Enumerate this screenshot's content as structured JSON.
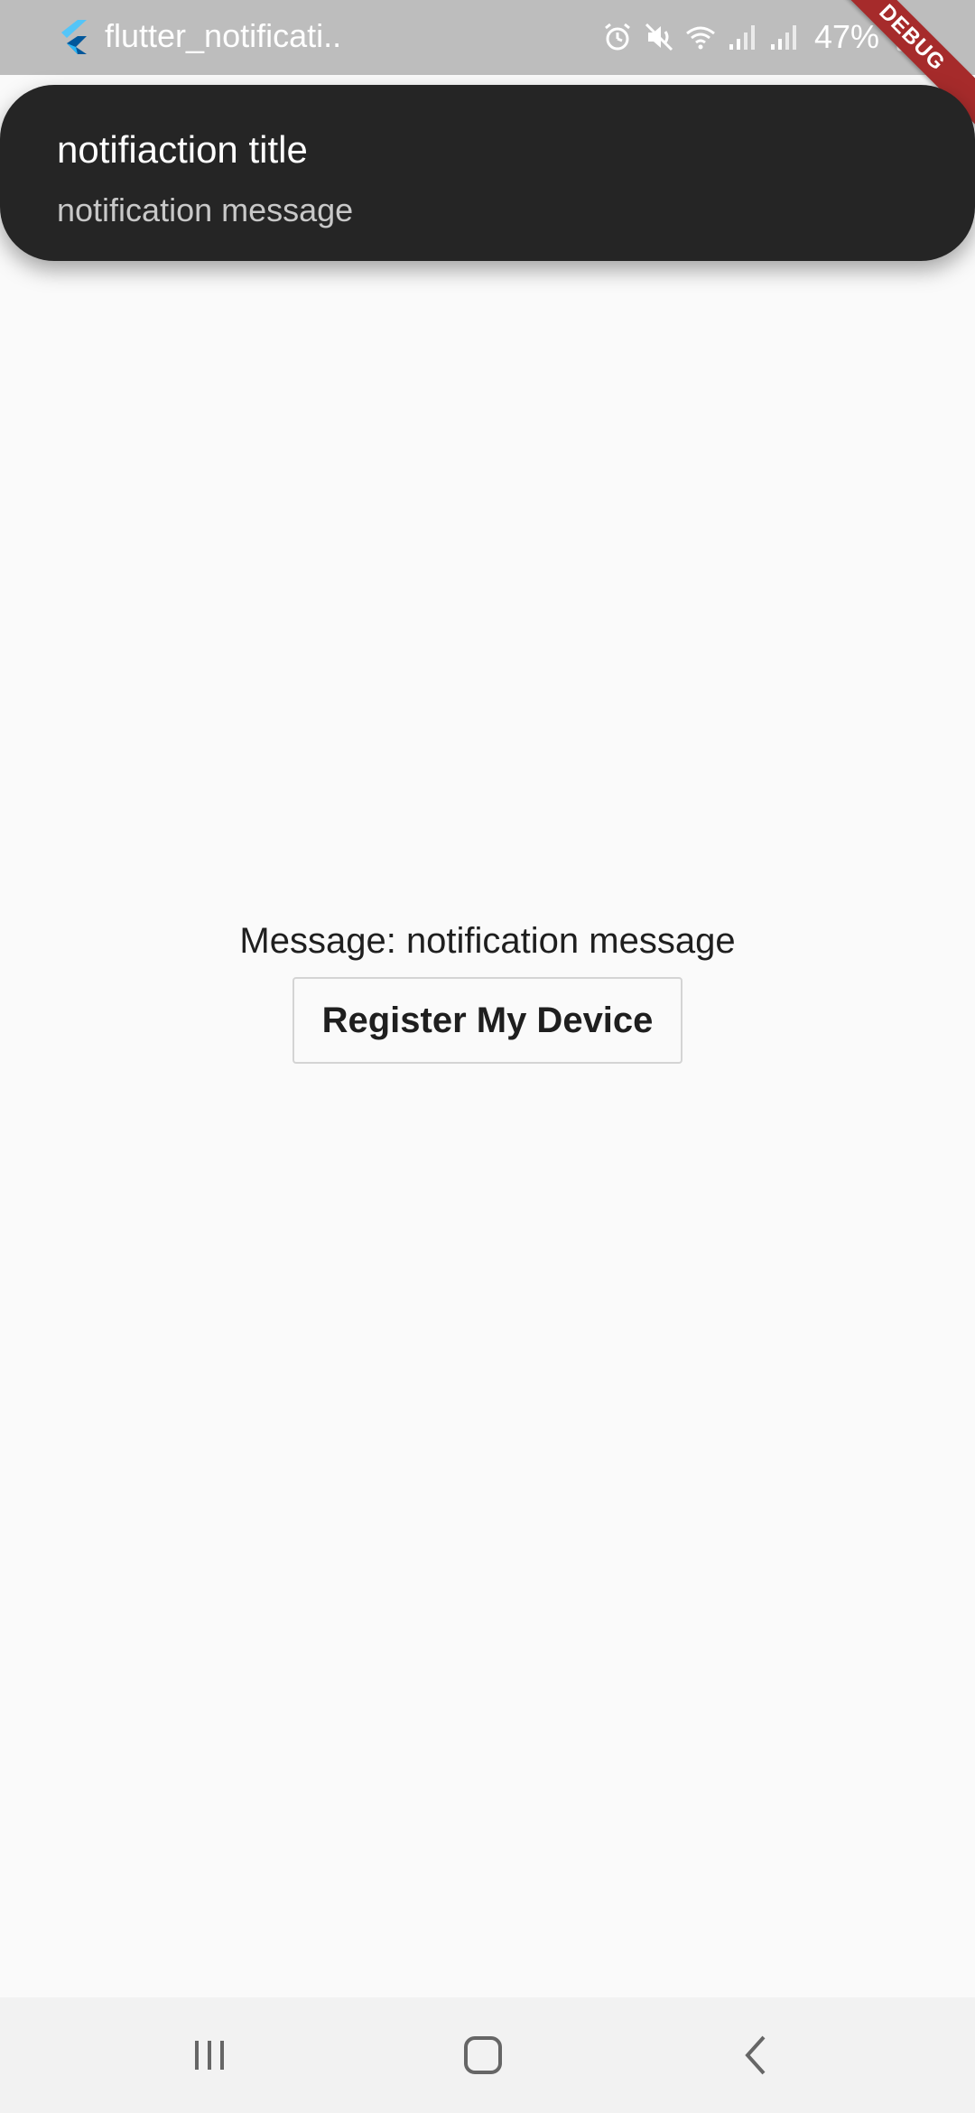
{
  "status_bar": {
    "app_title": "flutter_notificati..",
    "battery": "47%",
    "icons": [
      "flutter-icon",
      "alarm-icon",
      "mute-icon",
      "wifi-icon",
      "signal-icon",
      "signal-icon",
      "battery-icon"
    ]
  },
  "debug_banner": {
    "label": "DEBUG"
  },
  "notification": {
    "title": "notifiaction title",
    "message": "notification message"
  },
  "main": {
    "message_text": "Message: notification message",
    "register_button_label": "Register My Device"
  },
  "nav_bar": {
    "icons": [
      "recents-icon",
      "home-icon",
      "back-icon"
    ]
  },
  "colors": {
    "status_bar_bg": "#bdbdbd",
    "notification_bg": "#252525",
    "page_bg": "#fafafa",
    "debug_banner": "#a62b2b"
  }
}
